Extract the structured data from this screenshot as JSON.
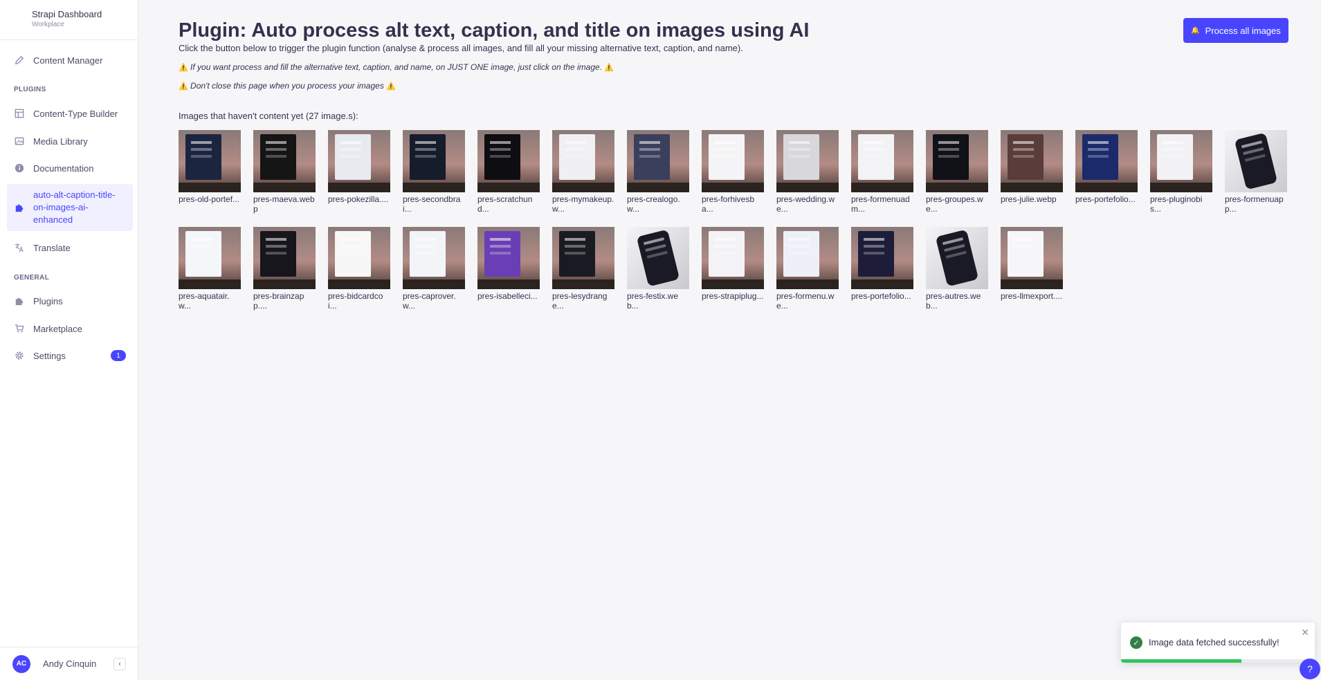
{
  "brand": {
    "title": "Strapi Dashboard",
    "subtitle": "Workplace"
  },
  "sidebar": {
    "content_manager": "Content Manager",
    "plugins_label": "PLUGINS",
    "plugins": [
      {
        "label": "Content-Type Builder",
        "icon": "layout-icon"
      },
      {
        "label": "Media Library",
        "icon": "image-icon"
      },
      {
        "label": "Documentation",
        "icon": "info-icon"
      },
      {
        "label": "auto-alt-caption-title-on-images-ai-enhanced",
        "icon": "puzzle-icon"
      },
      {
        "label": "Translate",
        "icon": "translate-icon"
      }
    ],
    "general_label": "GENERAL",
    "general": [
      {
        "label": "Plugins",
        "icon": "puzzle-icon"
      },
      {
        "label": "Marketplace",
        "icon": "cart-icon"
      },
      {
        "label": "Settings",
        "icon": "gear-icon",
        "badge": "1"
      }
    ]
  },
  "user": {
    "initials": "AC",
    "name": "Andy Cinquin"
  },
  "main": {
    "title": "Plugin: Auto process alt text, caption, and title on images using AI",
    "subtitle": "Click the button below to trigger the plugin function (analyse & process all images, and fill all your missing alternative text, caption, and name).",
    "note1": "If you want process and fill the alternative text, caption, and name, on JUST ONE image, just click on the image.",
    "note2": "Don't close this page when you process your images",
    "warning_glyph": "⚠️",
    "process_button": "Process all images",
    "count_label": "Images that haven't content yet (27 image.s):"
  },
  "images": [
    {
      "caption": "pres-old-portef...",
      "color": "#1c2540",
      "variant": "laptop"
    },
    {
      "caption": "pres-maeva.webp",
      "color": "#151515",
      "variant": "laptop"
    },
    {
      "caption": "pres-pokezilla....",
      "color": "#e9eaf0",
      "variant": "laptop"
    },
    {
      "caption": "pres-secondbrai...",
      "color": "#151c2c",
      "variant": "laptop"
    },
    {
      "caption": "pres-scratchund...",
      "color": "#0d0d12",
      "variant": "laptop"
    },
    {
      "caption": "pres-mymakeup.w...",
      "color": "#f0eff2",
      "variant": "laptop"
    },
    {
      "caption": "pres-crealogo.w...",
      "color": "#3a3f5c",
      "variant": "laptop"
    },
    {
      "caption": "pres-forhivesba...",
      "color": "#f4f4f6",
      "variant": "laptop"
    },
    {
      "caption": "pres-wedding.we...",
      "color": "#d8d8dc",
      "variant": "laptop"
    },
    {
      "caption": "pres-formenuadm...",
      "color": "#f3f3f6",
      "variant": "laptop"
    },
    {
      "caption": "pres-groupes.we...",
      "color": "#111118",
      "variant": "laptop"
    },
    {
      "caption": "pres-julie.webp",
      "color": "#5a3c3a",
      "variant": "laptop"
    },
    {
      "caption": "pres-portefolio...",
      "color": "#1b2a6b",
      "variant": "laptop"
    },
    {
      "caption": "pres-pluginobis...",
      "color": "#f2f2f4",
      "variant": "laptop"
    },
    {
      "caption": "pres-formenuapp...",
      "color": "#e6e6ee",
      "variant": "phone"
    },
    {
      "caption": "pres-aquatair.w...",
      "color": "#f4f6fa",
      "variant": "laptop"
    },
    {
      "caption": "pres-brainzapp....",
      "color": "#16161c",
      "variant": "laptop"
    },
    {
      "caption": "pres-bidcardcoi...",
      "color": "#f7f7f7",
      "variant": "laptop"
    },
    {
      "caption": "pres-caprover.w...",
      "color": "#f2f4f8",
      "variant": "laptop"
    },
    {
      "caption": "pres-isabelleci...",
      "color": "#6a3fb5",
      "variant": "laptop"
    },
    {
      "caption": "pres-lesydrange...",
      "color": "#1a1a22",
      "variant": "laptop"
    },
    {
      "caption": "pres-festix.web...",
      "color": "#dadae0",
      "variant": "phone"
    },
    {
      "caption": "pres-strapiplug...",
      "color": "#f3f3f6",
      "variant": "laptop"
    },
    {
      "caption": "pres-formenu.we...",
      "color": "#eef0f8",
      "variant": "laptop"
    },
    {
      "caption": "pres-portefolio...",
      "color": "#1d1d3a",
      "variant": "laptop"
    },
    {
      "caption": "pres-autres.web...",
      "color": "#d6d6de",
      "variant": "phone"
    },
    {
      "caption": "pres-llmexport....",
      "color": "#f6f6f8",
      "variant": "laptop"
    }
  ],
  "toast": {
    "message": "Image data fetched successfully!",
    "progress": 0.62
  },
  "colors": {
    "accent": "#4945ff",
    "success": "#328048"
  }
}
